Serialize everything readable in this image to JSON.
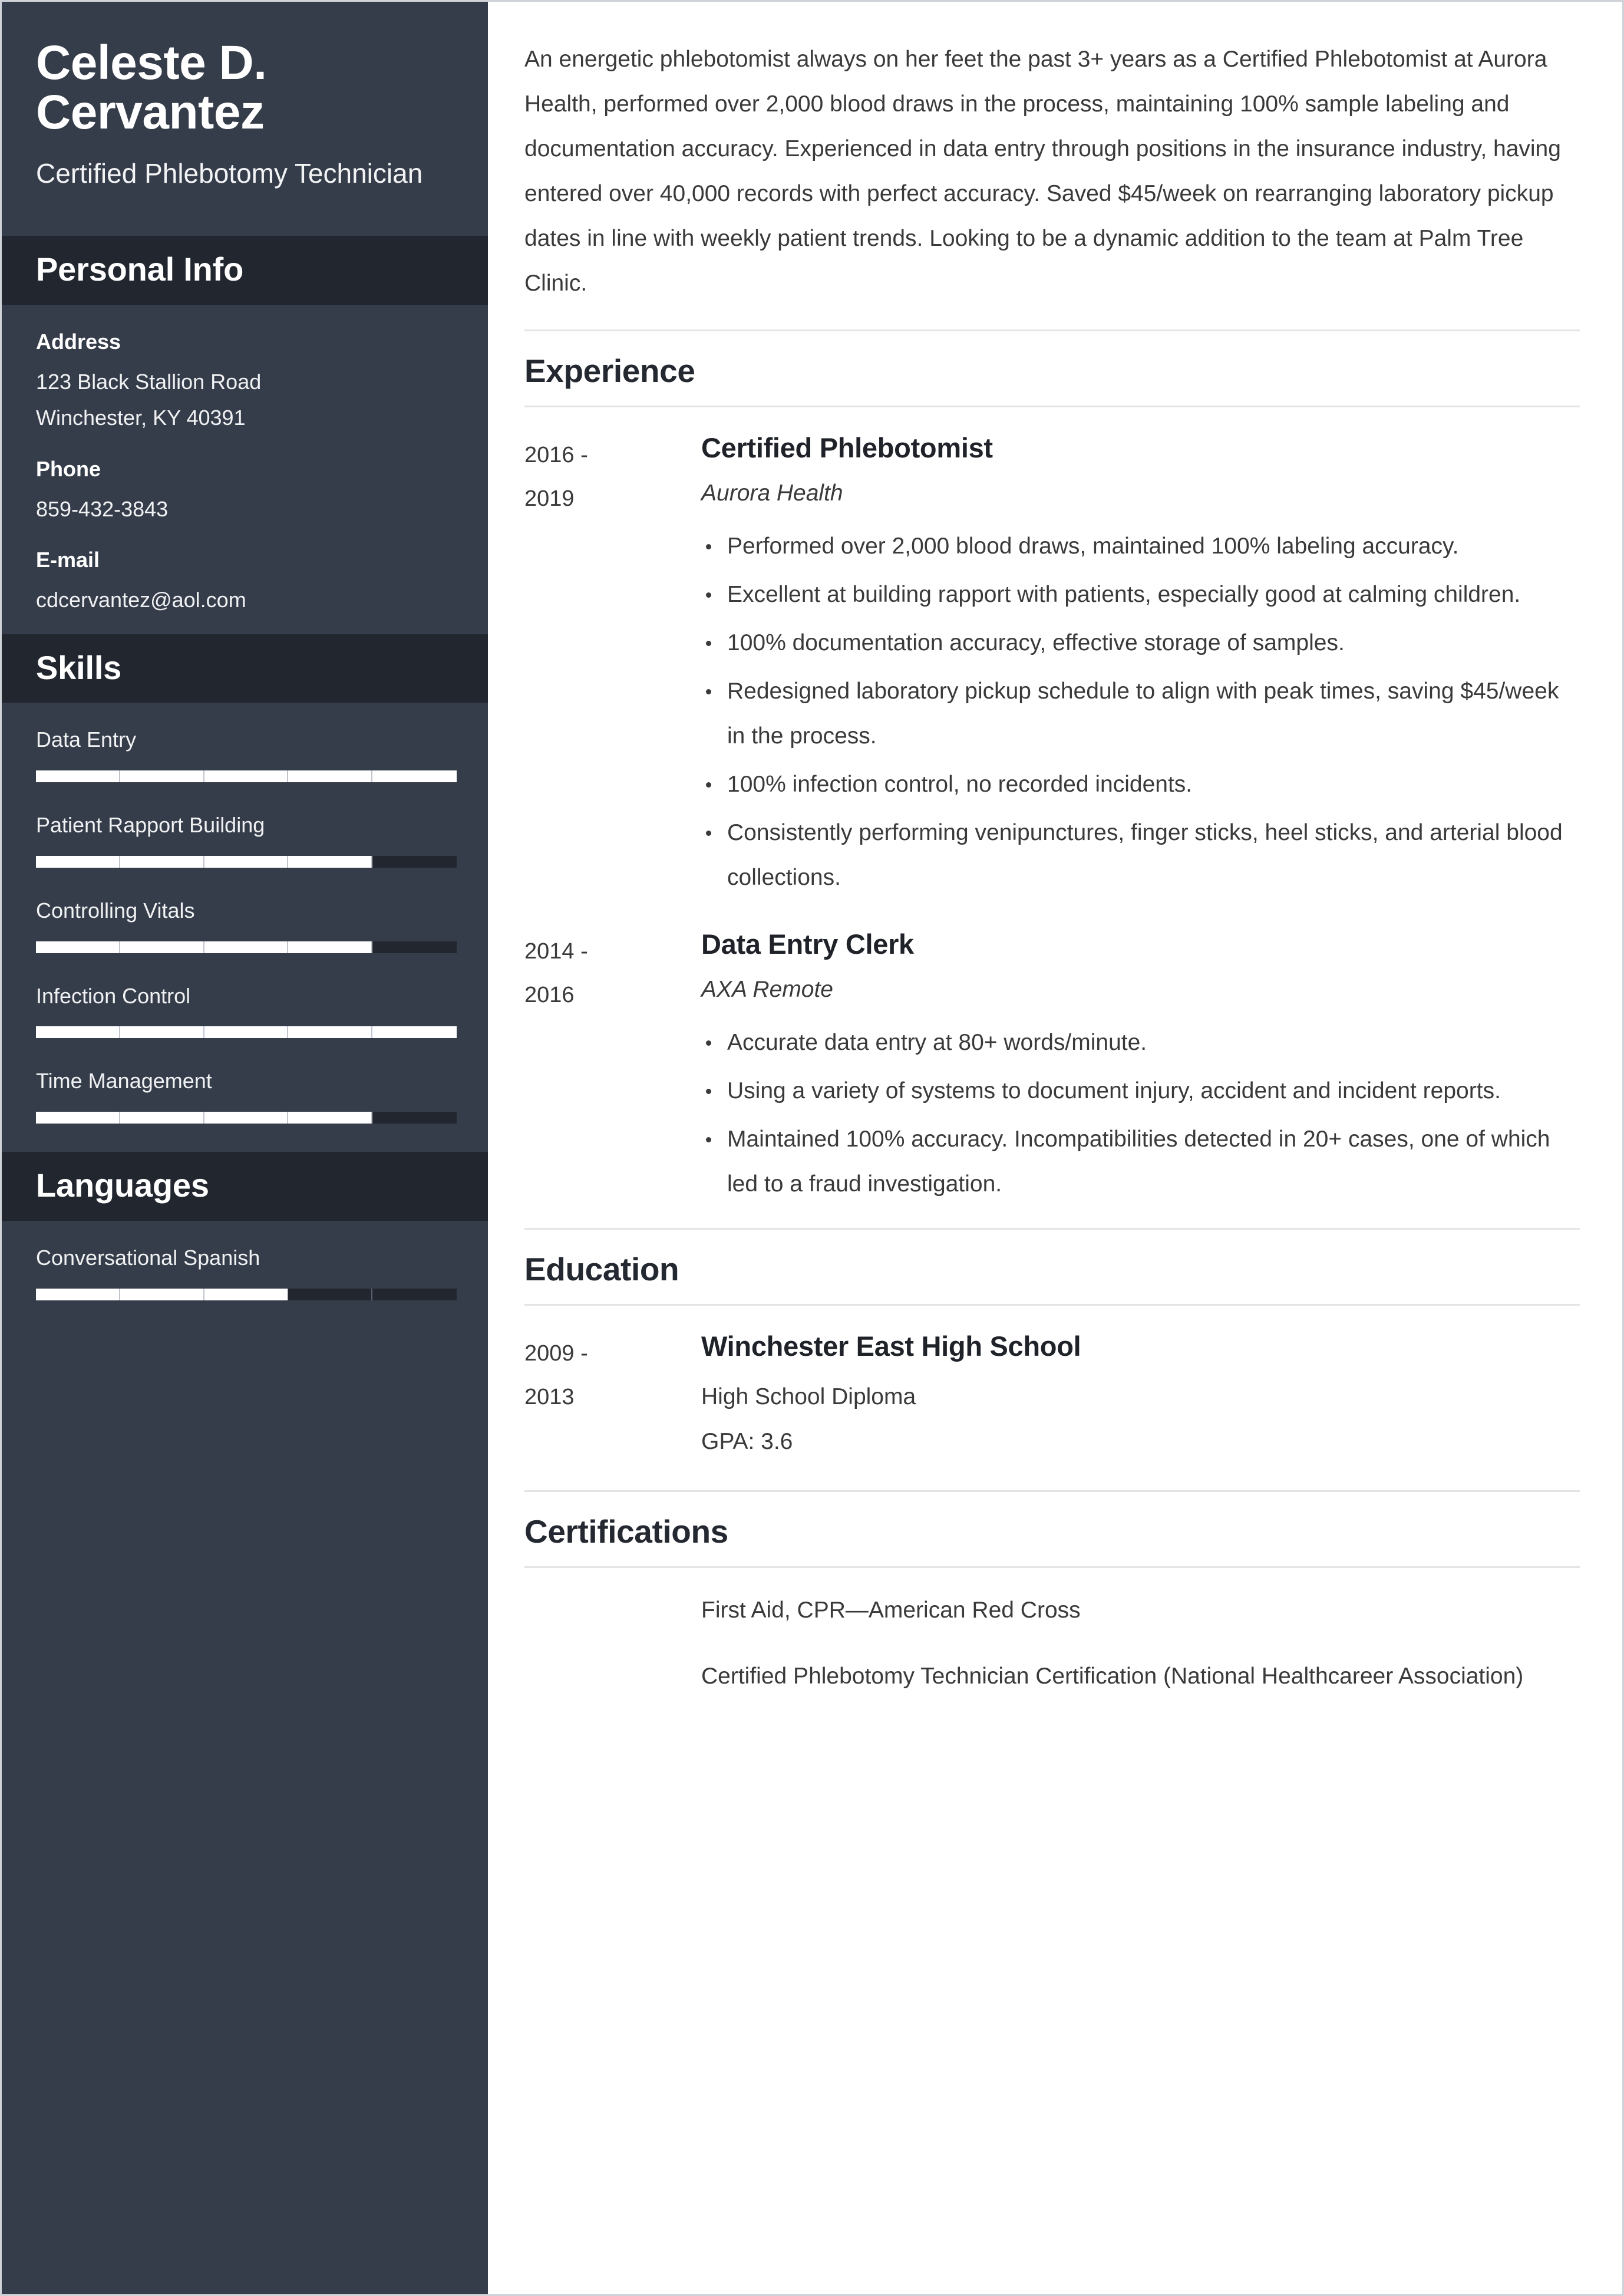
{
  "sidebar": {
    "name": "Celeste D. Cervantez",
    "job_title": "Certified Phlebotomy Technician",
    "personal_info": {
      "heading": "Personal Info",
      "fields": [
        {
          "label": "Address",
          "lines": [
            "123 Black Stallion Road",
            "Winchester, KY 40391"
          ]
        },
        {
          "label": "Phone",
          "lines": [
            "859-432-3843"
          ]
        },
        {
          "label": "E-mail",
          "lines": [
            "cdcervantez@aol.com"
          ]
        }
      ]
    },
    "skills": {
      "heading": "Skills",
      "items": [
        {
          "name": "Data Entry",
          "level": 100
        },
        {
          "name": "Patient Rapport Building",
          "level": 80
        },
        {
          "name": "Controlling Vitals",
          "level": 80
        },
        {
          "name": "Infection Control",
          "level": 100
        },
        {
          "name": "Time Management",
          "level": 80
        }
      ]
    },
    "languages": {
      "heading": "Languages",
      "items": [
        {
          "name": "Conversational Spanish",
          "level": 60
        }
      ]
    }
  },
  "main": {
    "summary": "An energetic phlebotomist always on her feet the past 3+ years as a Certified Phlebotomist at Aurora Health, performed over 2,000 blood draws in the process, maintaining 100% sample labeling and documentation accuracy. Experienced in data entry through positions in the insurance industry, having entered over 40,000 records with perfect accuracy. Saved $45/week on rearranging laboratory pickup dates in line with weekly patient trends. Looking to be a dynamic addition to the team at Palm Tree Clinic.",
    "experience": {
      "heading": "Experience",
      "entries": [
        {
          "date_start": "2016 -",
          "date_end": "2019",
          "role": "Certified Phlebotomist",
          "org": "Aurora Health",
          "bullets": [
            "Performed over 2,000 blood draws, maintained 100% labeling accuracy.",
            "Excellent at building rapport with patients, especially good at calming children.",
            "100% documentation accuracy, effective storage of samples.",
            "Redesigned laboratory pickup schedule to align with peak times, saving $45/week in the process.",
            "100% infection control, no recorded incidents.",
            "Consistently performing venipunctures, finger sticks, heel sticks, and arterial blood collections."
          ]
        },
        {
          "date_start": "2014 -",
          "date_end": "2016",
          "role": "Data Entry Clerk",
          "org": "AXA Remote",
          "bullets": [
            "Accurate data entry at 80+ words/minute.",
            "Using a variety of systems to document injury, accident and incident reports.",
            "Maintained 100% accuracy. Incompatibilities detected in 20+ cases, one of which led to a fraud investigation."
          ]
        }
      ]
    },
    "education": {
      "heading": "Education",
      "entries": [
        {
          "date_start": "2009 -",
          "date_end": "2013",
          "school": "Winchester East High School",
          "degree": "High School Diploma",
          "gpa": "GPA: 3.6"
        }
      ]
    },
    "certifications": {
      "heading": "Certifications",
      "items": [
        "First Aid, CPR—American Red Cross",
        "Certified Phlebotomy Technician Certification (National Healthcareer Association)"
      ]
    }
  },
  "colors": {
    "sidebar_bg": "#363d4a",
    "sidebar_band": "#22262f",
    "accent_white": "#ffffff",
    "text_dark": "#3a3a3a",
    "heading_dark": "#242830",
    "rule": "#e3e4e6",
    "page_border": "#cfd2d6"
  }
}
